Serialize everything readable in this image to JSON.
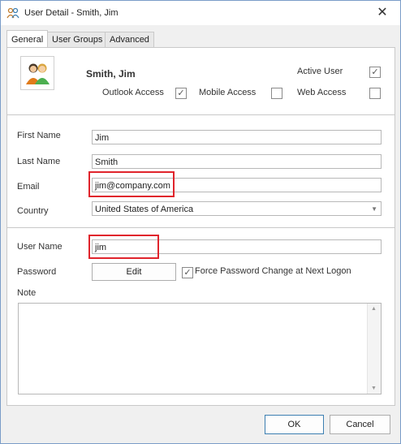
{
  "window": {
    "title": "User Detail - Smith, Jim",
    "close_glyph": "✕"
  },
  "tabs": [
    {
      "label": "General"
    },
    {
      "label": "User Groups"
    },
    {
      "label": "Advanced"
    }
  ],
  "user": {
    "display_name": "Smith, Jim"
  },
  "flags": {
    "active_user": {
      "label": "Active User",
      "checked": true
    },
    "outlook_access": {
      "label": "Outlook Access",
      "checked": true
    },
    "mobile_access": {
      "label": "Mobile Access",
      "checked": false
    },
    "web_access": {
      "label": "Web Access",
      "checked": false
    }
  },
  "fields": {
    "first_name": {
      "label": "First Name",
      "value": "Jim"
    },
    "last_name": {
      "label": "Last Name",
      "value": "Smith"
    },
    "email": {
      "label": "Email",
      "value": "jim@company.com"
    },
    "country": {
      "label": "Country",
      "value": "United States of America"
    },
    "user_name": {
      "label": "User Name",
      "value": "jim"
    },
    "password": {
      "label": "Password",
      "edit_label": "Edit"
    },
    "force_change": {
      "label": "Force Password Change at Next Logon",
      "checked": true
    },
    "note": {
      "label": "Note",
      "value": ""
    }
  },
  "buttons": {
    "ok": "OK",
    "cancel": "Cancel"
  },
  "check_glyph": "✓",
  "icons": {
    "title": "users-icon",
    "avatar": "user-pair-icon",
    "dropdown": "chevron-down-icon"
  },
  "colors": {
    "highlight": "#e0242c",
    "accent": "#3c7fb1"
  }
}
